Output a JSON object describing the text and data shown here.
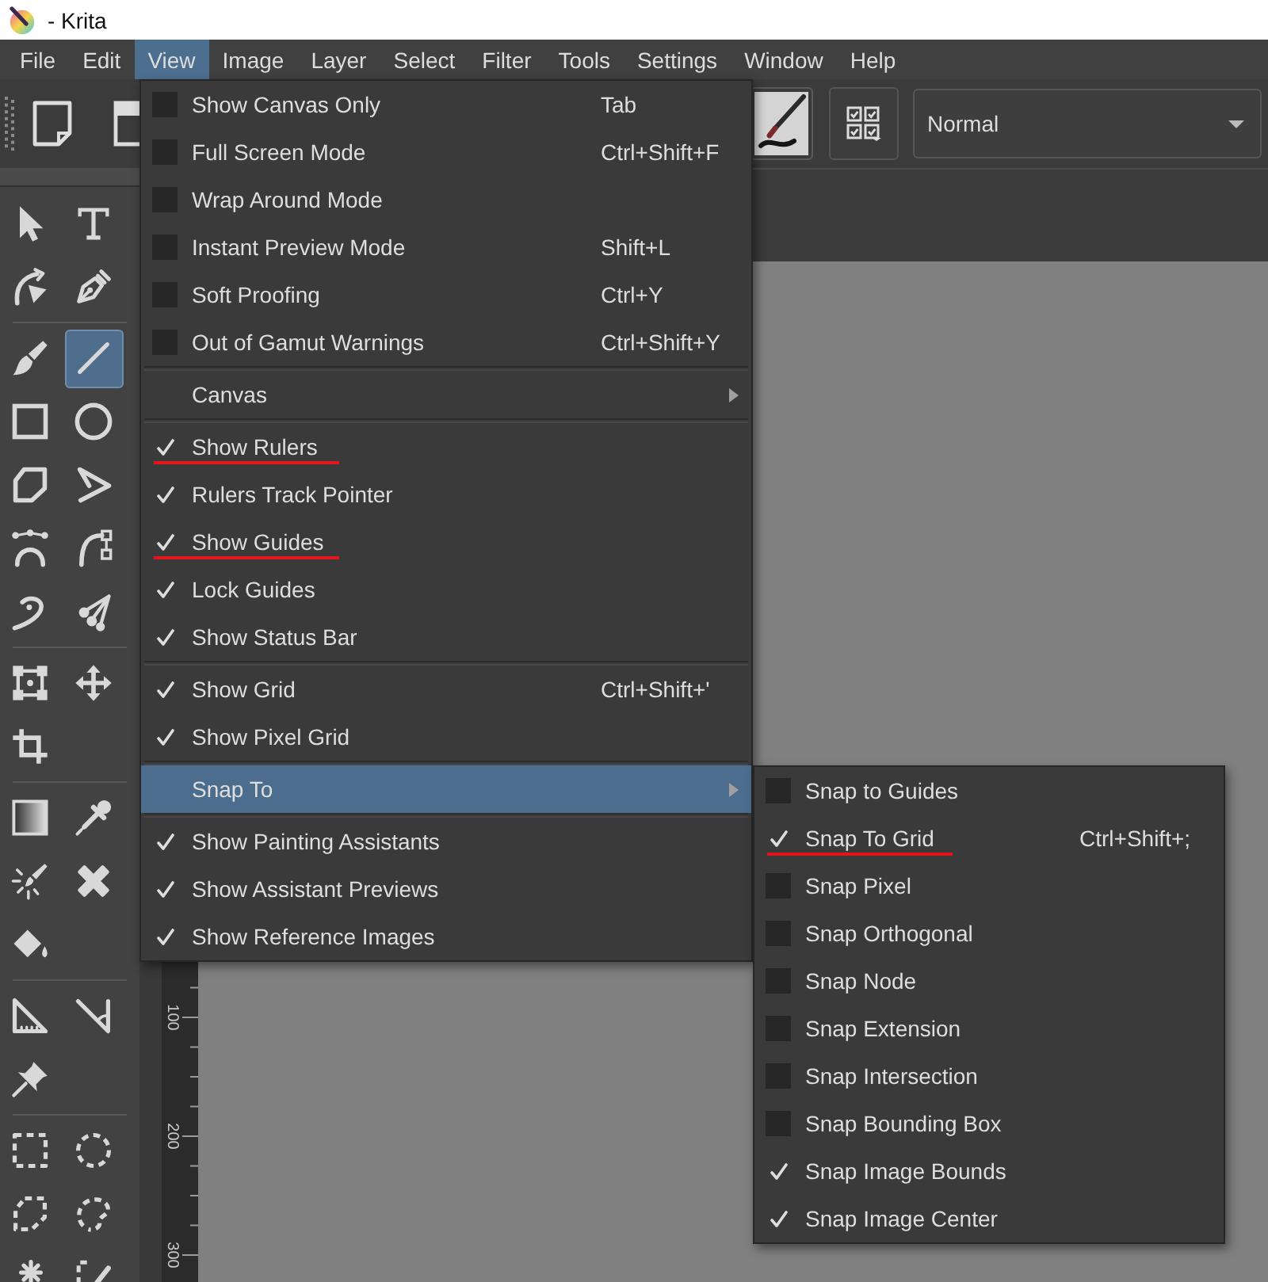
{
  "window": {
    "title": "- Krita"
  },
  "menu_bar": [
    {
      "label": "File",
      "selected": false
    },
    {
      "label": "Edit",
      "selected": false
    },
    {
      "label": "View",
      "selected": true
    },
    {
      "label": "Image",
      "selected": false
    },
    {
      "label": "Layer",
      "selected": false
    },
    {
      "label": "Select",
      "selected": false
    },
    {
      "label": "Filter",
      "selected": false
    },
    {
      "label": "Tools",
      "selected": false
    },
    {
      "label": "Settings",
      "selected": false
    },
    {
      "label": "Window",
      "selected": false
    },
    {
      "label": "Help",
      "selected": false
    }
  ],
  "toolbar": {
    "blend_mode": "Normal"
  },
  "toolbox": {
    "groups": [
      {
        "tools": [
          {
            "selected": false
          },
          {
            "selected": false
          },
          {
            "selected": false
          },
          {
            "selected": false
          }
        ]
      },
      {
        "tools": [
          {
            "selected": false
          },
          {
            "selected": true
          },
          {
            "selected": false
          },
          {
            "selected": false
          },
          {
            "selected": false
          },
          {
            "selected": false
          },
          {
            "selected": false
          },
          {
            "selected": false
          },
          {
            "selected": false
          },
          {
            "selected": false
          }
        ]
      },
      {
        "tools": [
          {
            "selected": false
          },
          {
            "selected": false
          },
          {
            "selected": false
          }
        ]
      },
      {
        "tools": [
          {
            "selected": false
          },
          {
            "selected": false
          },
          {
            "selected": false
          },
          {
            "selected": false
          },
          {
            "selected": false
          }
        ]
      },
      {
        "tools": [
          {
            "selected": false
          },
          {
            "selected": false
          },
          {
            "selected": false
          }
        ]
      },
      {
        "tools": [
          {
            "selected": false
          },
          {
            "selected": false
          },
          {
            "selected": false
          },
          {
            "selected": false
          },
          {
            "selected": false
          },
          {
            "selected": false
          }
        ]
      }
    ]
  },
  "view_menu": {
    "sections": [
      {
        "items": [
          {
            "kind": "check",
            "label": "Show Canvas Only",
            "shortcut": "Tab",
            "checked": false,
            "selected": false,
            "underlined": false
          },
          {
            "kind": "check",
            "label": "Full Screen Mode",
            "shortcut": "Ctrl+Shift+F",
            "checked": false,
            "selected": false,
            "underlined": false
          },
          {
            "kind": "check",
            "label": "Wrap Around Mode",
            "checked": false,
            "selected": false,
            "underlined": false
          },
          {
            "kind": "check",
            "label": "Instant Preview Mode",
            "shortcut": "Shift+L",
            "checked": false,
            "selected": false,
            "underlined": false
          },
          {
            "kind": "check",
            "label": "Soft Proofing",
            "shortcut": "Ctrl+Y",
            "checked": false,
            "selected": false,
            "underlined": false
          },
          {
            "kind": "check",
            "label": "Out of Gamut Warnings",
            "shortcut": "Ctrl+Shift+Y",
            "checked": false,
            "selected": false,
            "underlined": false
          }
        ]
      },
      {
        "items": [
          {
            "kind": "submenu",
            "label": "Canvas",
            "selected": false
          }
        ]
      },
      {
        "items": [
          {
            "kind": "check",
            "label": "Show Rulers",
            "checked": true,
            "selected": false,
            "underlined": true
          },
          {
            "kind": "check",
            "label": "Rulers Track Pointer",
            "checked": true,
            "selected": false,
            "underlined": false
          },
          {
            "kind": "check",
            "label": "Show Guides",
            "checked": true,
            "selected": false,
            "underlined": true
          },
          {
            "kind": "check",
            "label": "Lock Guides",
            "checked": true,
            "selected": false,
            "underlined": false
          },
          {
            "kind": "check",
            "label": "Show Status Bar",
            "checked": true,
            "selected": false,
            "underlined": false
          }
        ]
      },
      {
        "items": [
          {
            "kind": "check",
            "label": "Show Grid",
            "shortcut": "Ctrl+Shift+'",
            "checked": true,
            "selected": false,
            "underlined": false
          },
          {
            "kind": "check",
            "label": "Show Pixel Grid",
            "checked": true,
            "selected": false,
            "underlined": false
          }
        ]
      },
      {
        "items": [
          {
            "kind": "submenu",
            "label": "Snap To",
            "selected": true
          }
        ]
      },
      {
        "items": [
          {
            "kind": "check",
            "label": "Show Painting Assistants",
            "checked": true,
            "selected": false,
            "underlined": false
          },
          {
            "kind": "check",
            "label": "Show Assistant Previews",
            "checked": true,
            "selected": false,
            "underlined": false
          },
          {
            "kind": "check",
            "label": "Show Reference Images",
            "checked": true,
            "selected": false,
            "underlined": false
          }
        ]
      }
    ]
  },
  "snap_menu": {
    "items": [
      {
        "kind": "check",
        "label": "Snap to Guides",
        "checked": false,
        "selected": false,
        "underlined": false
      },
      {
        "kind": "check",
        "label": "Snap To Grid",
        "shortcut": "Ctrl+Shift+;",
        "checked": true,
        "selected": false,
        "underlined": true
      },
      {
        "kind": "check",
        "label": "Snap Pixel",
        "checked": false,
        "selected": false,
        "underlined": false
      },
      {
        "kind": "check",
        "label": "Snap Orthogonal",
        "checked": false,
        "selected": false,
        "underlined": false
      },
      {
        "kind": "check",
        "label": "Snap Node",
        "checked": false,
        "selected": false,
        "underlined": false
      },
      {
        "kind": "check",
        "label": "Snap Extension",
        "checked": false,
        "selected": false,
        "underlined": false
      },
      {
        "kind": "check",
        "label": "Snap Intersection",
        "checked": false,
        "selected": false,
        "underlined": false
      },
      {
        "kind": "check",
        "label": "Snap Bounding Box",
        "checked": false,
        "selected": false,
        "underlined": false
      },
      {
        "kind": "check",
        "label": "Snap Image Bounds",
        "checked": true,
        "selected": false,
        "underlined": false
      },
      {
        "kind": "check",
        "label": "Snap Image Center",
        "checked": true,
        "selected": false,
        "underlined": false
      }
    ]
  },
  "ruler": {
    "labels": [
      "100",
      "200",
      "300"
    ]
  }
}
